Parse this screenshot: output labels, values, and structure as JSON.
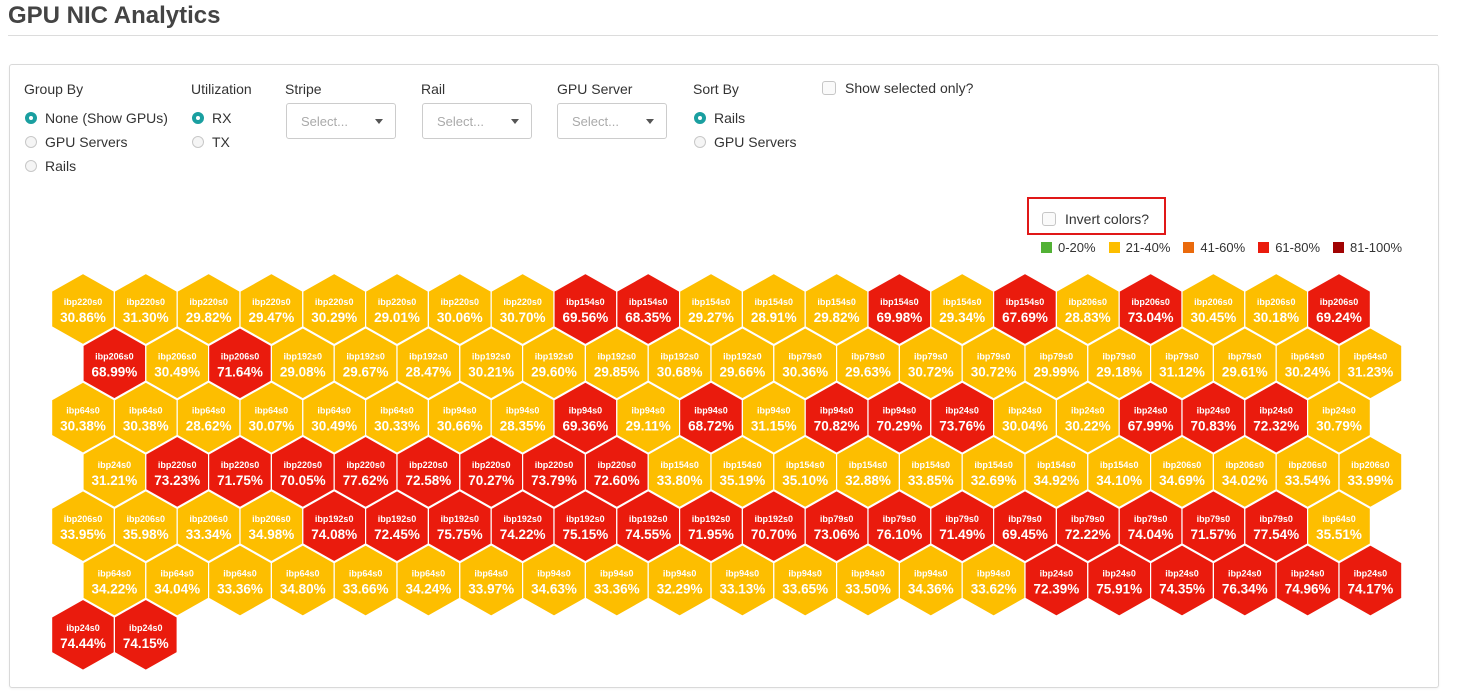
{
  "page": {
    "title": "GPU NIC Analytics"
  },
  "controls": {
    "group_by": {
      "label": "Group By",
      "options": [
        "None (Show GPUs)",
        "GPU Servers",
        "Rails"
      ],
      "selected": 0
    },
    "utilization": {
      "label": "Utilization",
      "options": [
        "RX",
        "TX"
      ],
      "selected": 0
    },
    "stripe": {
      "label": "Stripe",
      "placeholder": "Select..."
    },
    "rail": {
      "label": "Rail",
      "placeholder": "Select..."
    },
    "gpu_server": {
      "label": "GPU Server",
      "placeholder": "Select..."
    },
    "sort_by": {
      "label": "Sort By",
      "options": [
        "Rails",
        "GPU Servers"
      ],
      "selected": 0
    },
    "show_selected_only": {
      "label": "Show selected only?",
      "checked": false
    },
    "invert_colors": {
      "label": "Invert colors?",
      "checked": false
    }
  },
  "legend": [
    {
      "label": "0-20%",
      "color": "#52b135"
    },
    {
      "label": "21-40%",
      "color": "#fdbe00"
    },
    {
      "label": "41-60%",
      "color": "#ea6a0c"
    },
    {
      "label": "61-80%",
      "color": "#ea1b0d"
    },
    {
      "label": "81-100%",
      "color": "#a10303"
    }
  ],
  "hexes": [
    {
      "name": "ibp220s0",
      "value": "30.86%"
    },
    {
      "name": "ibp220s0",
      "value": "31.30%"
    },
    {
      "name": "ibp220s0",
      "value": "29.82%"
    },
    {
      "name": "ibp220s0",
      "value": "29.47%"
    },
    {
      "name": "ibp220s0",
      "value": "30.29%"
    },
    {
      "name": "ibp220s0",
      "value": "29.01%"
    },
    {
      "name": "ibp220s0",
      "value": "30.06%"
    },
    {
      "name": "ibp220s0",
      "value": "30.70%"
    },
    {
      "name": "ibp154s0",
      "value": "69.56%"
    },
    {
      "name": "ibp154s0",
      "value": "68.35%"
    },
    {
      "name": "ibp154s0",
      "value": "29.27%"
    },
    {
      "name": "ibp154s0",
      "value": "28.91%"
    },
    {
      "name": "ibp154s0",
      "value": "29.82%"
    },
    {
      "name": "ibp154s0",
      "value": "69.98%"
    },
    {
      "name": "ibp154s0",
      "value": "29.34%"
    },
    {
      "name": "ibp154s0",
      "value": "67.69%"
    },
    {
      "name": "ibp206s0",
      "value": "28.83%"
    },
    {
      "name": "ibp206s0",
      "value": "73.04%"
    },
    {
      "name": "ibp206s0",
      "value": "30.45%"
    },
    {
      "name": "ibp206s0",
      "value": "30.18%"
    },
    {
      "name": "ibp206s0",
      "value": "69.24%"
    },
    {
      "name": "ibp206s0",
      "value": "68.99%"
    },
    {
      "name": "ibp206s0",
      "value": "30.49%"
    },
    {
      "name": "ibp206s0",
      "value": "71.64%"
    },
    {
      "name": "ibp192s0",
      "value": "29.08%"
    },
    {
      "name": "ibp192s0",
      "value": "29.67%"
    },
    {
      "name": "ibp192s0",
      "value": "28.47%"
    },
    {
      "name": "ibp192s0",
      "value": "30.21%"
    },
    {
      "name": "ibp192s0",
      "value": "29.60%"
    },
    {
      "name": "ibp192s0",
      "value": "29.85%"
    },
    {
      "name": "ibp192s0",
      "value": "30.68%"
    },
    {
      "name": "ibp192s0",
      "value": "29.66%"
    },
    {
      "name": "ibp79s0",
      "value": "30.36%"
    },
    {
      "name": "ibp79s0",
      "value": "29.63%"
    },
    {
      "name": "ibp79s0",
      "value": "30.72%"
    },
    {
      "name": "ibp79s0",
      "value": "30.72%"
    },
    {
      "name": "ibp79s0",
      "value": "29.99%"
    },
    {
      "name": "ibp79s0",
      "value": "29.18%"
    },
    {
      "name": "ibp79s0",
      "value": "31.12%"
    },
    {
      "name": "ibp79s0",
      "value": "29.61%"
    },
    {
      "name": "ibp64s0",
      "value": "30.24%"
    },
    {
      "name": "ibp64s0",
      "value": "31.23%"
    },
    {
      "name": "ibp64s0",
      "value": "30.38%"
    },
    {
      "name": "ibp64s0",
      "value": "30.38%"
    },
    {
      "name": "ibp64s0",
      "value": "28.62%"
    },
    {
      "name": "ibp64s0",
      "value": "30.07%"
    },
    {
      "name": "ibp64s0",
      "value": "30.49%"
    },
    {
      "name": "ibp64s0",
      "value": "30.33%"
    },
    {
      "name": "ibp94s0",
      "value": "30.66%"
    },
    {
      "name": "ibp94s0",
      "value": "28.35%"
    },
    {
      "name": "ibp94s0",
      "value": "69.36%"
    },
    {
      "name": "ibp94s0",
      "value": "29.11%"
    },
    {
      "name": "ibp94s0",
      "value": "68.72%"
    },
    {
      "name": "ibp94s0",
      "value": "31.15%"
    },
    {
      "name": "ibp94s0",
      "value": "70.82%"
    },
    {
      "name": "ibp94s0",
      "value": "70.29%"
    },
    {
      "name": "ibp24s0",
      "value": "73.76%"
    },
    {
      "name": "ibp24s0",
      "value": "30.04%"
    },
    {
      "name": "ibp24s0",
      "value": "30.22%"
    },
    {
      "name": "ibp24s0",
      "value": "67.99%"
    },
    {
      "name": "ibp24s0",
      "value": "70.83%"
    },
    {
      "name": "ibp24s0",
      "value": "72.32%"
    },
    {
      "name": "ibp24s0",
      "value": "30.79%"
    },
    {
      "name": "ibp24s0",
      "value": "31.21%"
    },
    {
      "name": "ibp220s0",
      "value": "73.23%"
    },
    {
      "name": "ibp220s0",
      "value": "71.75%"
    },
    {
      "name": "ibp220s0",
      "value": "70.05%"
    },
    {
      "name": "ibp220s0",
      "value": "77.62%"
    },
    {
      "name": "ibp220s0",
      "value": "72.58%"
    },
    {
      "name": "ibp220s0",
      "value": "70.27%"
    },
    {
      "name": "ibp220s0",
      "value": "73.79%"
    },
    {
      "name": "ibp220s0",
      "value": "72.60%"
    },
    {
      "name": "ibp154s0",
      "value": "33.80%"
    },
    {
      "name": "ibp154s0",
      "value": "35.19%"
    },
    {
      "name": "ibp154s0",
      "value": "35.10%"
    },
    {
      "name": "ibp154s0",
      "value": "32.88%"
    },
    {
      "name": "ibp154s0",
      "value": "33.85%"
    },
    {
      "name": "ibp154s0",
      "value": "32.69%"
    },
    {
      "name": "ibp154s0",
      "value": "34.92%"
    },
    {
      "name": "ibp154s0",
      "value": "34.10%"
    },
    {
      "name": "ibp206s0",
      "value": "34.69%"
    },
    {
      "name": "ibp206s0",
      "value": "34.02%"
    },
    {
      "name": "ibp206s0",
      "value": "33.54%"
    },
    {
      "name": "ibp206s0",
      "value": "33.99%"
    },
    {
      "name": "ibp206s0",
      "value": "33.95%"
    },
    {
      "name": "ibp206s0",
      "value": "35.98%"
    },
    {
      "name": "ibp206s0",
      "value": "33.34%"
    },
    {
      "name": "ibp206s0",
      "value": "34.98%"
    },
    {
      "name": "ibp192s0",
      "value": "74.08%"
    },
    {
      "name": "ibp192s0",
      "value": "72.45%"
    },
    {
      "name": "ibp192s0",
      "value": "75.75%"
    },
    {
      "name": "ibp192s0",
      "value": "74.22%"
    },
    {
      "name": "ibp192s0",
      "value": "75.15%"
    },
    {
      "name": "ibp192s0",
      "value": "74.55%"
    },
    {
      "name": "ibp192s0",
      "value": "71.95%"
    },
    {
      "name": "ibp192s0",
      "value": "70.70%"
    },
    {
      "name": "ibp79s0",
      "value": "73.06%"
    },
    {
      "name": "ibp79s0",
      "value": "76.10%"
    },
    {
      "name": "ibp79s0",
      "value": "71.49%"
    },
    {
      "name": "ibp79s0",
      "value": "69.45%"
    },
    {
      "name": "ibp79s0",
      "value": "72.22%"
    },
    {
      "name": "ibp79s0",
      "value": "74.04%"
    },
    {
      "name": "ibp79s0",
      "value": "71.57%"
    },
    {
      "name": "ibp79s0",
      "value": "77.54%"
    },
    {
      "name": "ibp64s0",
      "value": "35.51%"
    },
    {
      "name": "ibp64s0",
      "value": "34.22%"
    },
    {
      "name": "ibp64s0",
      "value": "34.04%"
    },
    {
      "name": "ibp64s0",
      "value": "33.36%"
    },
    {
      "name": "ibp64s0",
      "value": "34.80%"
    },
    {
      "name": "ibp64s0",
      "value": "33.66%"
    },
    {
      "name": "ibp64s0",
      "value": "34.24%"
    },
    {
      "name": "ibp64s0",
      "value": "33.97%"
    },
    {
      "name": "ibp94s0",
      "value": "34.63%"
    },
    {
      "name": "ibp94s0",
      "value": "33.36%"
    },
    {
      "name": "ibp94s0",
      "value": "32.29%"
    },
    {
      "name": "ibp94s0",
      "value": "33.13%"
    },
    {
      "name": "ibp94s0",
      "value": "33.65%"
    },
    {
      "name": "ibp94s0",
      "value": "33.50%"
    },
    {
      "name": "ibp94s0",
      "value": "34.36%"
    },
    {
      "name": "ibp94s0",
      "value": "33.62%"
    },
    {
      "name": "ibp24s0",
      "value": "72.39%"
    },
    {
      "name": "ibp24s0",
      "value": "75.91%"
    },
    {
      "name": "ibp24s0",
      "value": "74.35%"
    },
    {
      "name": "ibp24s0",
      "value": "76.34%"
    },
    {
      "name": "ibp24s0",
      "value": "74.96%"
    },
    {
      "name": "ibp24s0",
      "value": "74.17%"
    },
    {
      "name": "ibp24s0",
      "value": "74.44%"
    },
    {
      "name": "ibp24s0",
      "value": "74.15%"
    }
  ]
}
